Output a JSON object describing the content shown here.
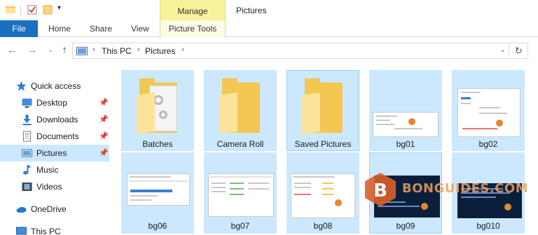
{
  "ribbon": {
    "context_group": "Manage",
    "window_title": "Pictures",
    "tabs": [
      "File",
      "Home",
      "Share",
      "View",
      "Picture Tools"
    ]
  },
  "address": {
    "crumbs": [
      "This PC",
      "Pictures"
    ]
  },
  "sidebar": {
    "items": [
      {
        "label": "Quick access",
        "icon": "star-icon"
      },
      {
        "label": "Desktop",
        "icon": "desktop-icon",
        "pinned": true
      },
      {
        "label": "Downloads",
        "icon": "download-icon",
        "pinned": true
      },
      {
        "label": "Documents",
        "icon": "documents-icon",
        "pinned": true
      },
      {
        "label": "Pictures",
        "icon": "pictures-icon",
        "pinned": true,
        "selected": true
      },
      {
        "label": "Music",
        "icon": "music-icon"
      },
      {
        "label": "Videos",
        "icon": "videos-icon"
      },
      {
        "label": "OneDrive",
        "icon": "cloud-icon"
      },
      {
        "label": "This PC",
        "icon": "pc-icon"
      }
    ]
  },
  "files": [
    {
      "name": "Batches",
      "kind": "folder"
    },
    {
      "name": "Camera Roll",
      "kind": "folder"
    },
    {
      "name": "Saved Pictures",
      "kind": "folder"
    },
    {
      "name": "bg01",
      "kind": "image"
    },
    {
      "name": "bg02",
      "kind": "image"
    },
    {
      "name": "bg06",
      "kind": "image"
    },
    {
      "name": "bg07",
      "kind": "image"
    },
    {
      "name": "bg08",
      "kind": "image"
    },
    {
      "name": "bg09",
      "kind": "image"
    },
    {
      "name": "bg010",
      "kind": "image"
    }
  ],
  "watermark": "BONGUIDES.COM",
  "colors": {
    "file_tab": "#1a6fc0",
    "selection": "#cce8ff",
    "manage_tab": "#f9f29c",
    "folder": "#f3c752"
  }
}
